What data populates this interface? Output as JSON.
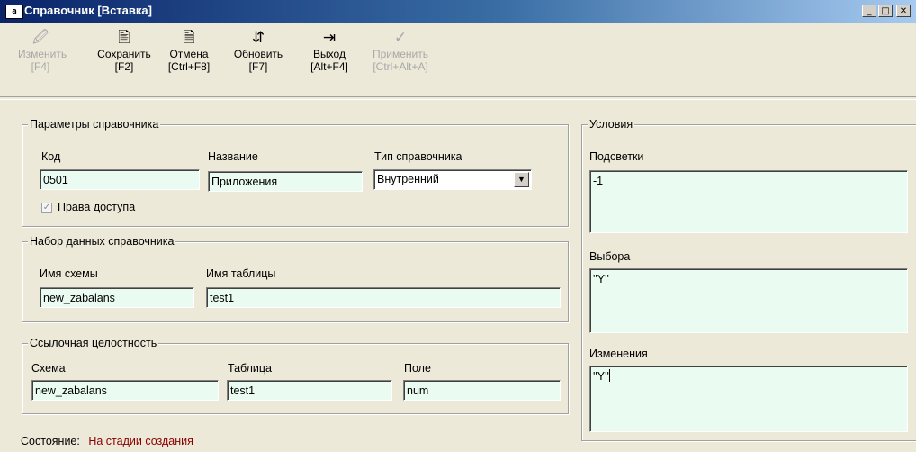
{
  "window": {
    "title": "Справочник [Вставка]",
    "icon_text": "a"
  },
  "toolbar": {
    "items": [
      {
        "name": "edit",
        "label_pre": "",
        "label_u": "И",
        "label_post": "зменить",
        "key": "[F4]",
        "icon": "edit-icon",
        "glyph": "🖉",
        "enabled": false
      },
      {
        "name": "save",
        "label_pre": "",
        "label_u": "С",
        "label_post": "охранить",
        "key": "[F2]",
        "icon": "save-icon",
        "glyph": "🖹",
        "enabled": true
      },
      {
        "name": "cancel",
        "label_pre": "",
        "label_u": "О",
        "label_post": "тмена",
        "key": "[Ctrl+F8]",
        "icon": "cancel-icon",
        "glyph": "🗎",
        "enabled": true
      },
      {
        "name": "refresh",
        "label_pre": "Обнови",
        "label_u": "т",
        "label_post": "ь",
        "key": "[F7]",
        "icon": "refresh-icon",
        "glyph": "⇵",
        "enabled": true
      },
      {
        "name": "exit",
        "label_pre": "В",
        "label_u": "ы",
        "label_post": "ход",
        "key": "[Alt+F4]",
        "icon": "exit-icon",
        "glyph": "⇥",
        "enabled": true
      },
      {
        "name": "apply",
        "label_pre": "",
        "label_u": "П",
        "label_post": "рименить",
        "key": "[Ctrl+Alt+A]",
        "icon": "checkmark-icon",
        "glyph": "✓",
        "enabled": false
      }
    ]
  },
  "params": {
    "legend": "Параметры справочника",
    "code_label": "Код",
    "code_value": "0501",
    "name_label": "Название",
    "name_value": "Приложения",
    "type_label": "Тип справочника",
    "type_value": "Внутренний",
    "access_label": "Права доступа",
    "access_checked": true
  },
  "dataset": {
    "legend": "Набор данных справочника",
    "schema_label": "Имя схемы",
    "schema_value": "new_zabalans",
    "table_label": "Имя таблицы",
    "table_value": "test1"
  },
  "integrity": {
    "legend": "Ссылочная целостность",
    "schema_label": "Схема",
    "schema_value": "new_zabalans",
    "table_label": "Таблица",
    "table_value": "test1",
    "field_label": "Поле",
    "field_value": "num"
  },
  "conditions": {
    "legend": "Условия",
    "highlight_label": "Подсветки",
    "highlight_value": "-1",
    "select_label": "Выбора",
    "select_value": "''Y''",
    "change_label": "Изменения",
    "change_value": "''Y''"
  },
  "status": {
    "label": "Состояние:",
    "value": "На стадии создания",
    "color": "#8b0000"
  }
}
